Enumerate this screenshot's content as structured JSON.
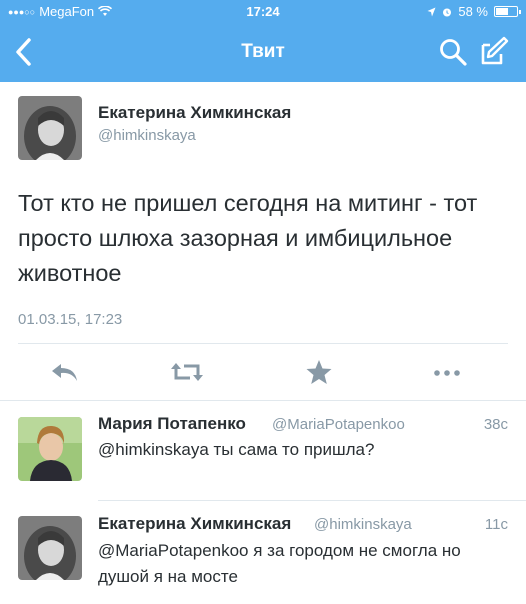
{
  "status_bar": {
    "carrier": "MegaFon",
    "time": "17:24",
    "battery": "58 %",
    "battery_level": 0.58
  },
  "nav": {
    "title": "Твит"
  },
  "tweet": {
    "author_name": "Екатерина Химкинская",
    "author_handle": "@himkinskaya",
    "text": "Тот кто не пришел сегодня на митинг - тот просто шлюха зазорная и имбицильное животное",
    "date": "01.03.15, 17:23"
  },
  "actions": [
    "reply-icon",
    "retweet-icon",
    "favorite-icon",
    "more-icon"
  ],
  "replies": [
    {
      "name": "Мария Потапенко",
      "handle": "@MariaPotapenkoo",
      "time": "38с",
      "text": "@himkinskaya ты сама то пришла?"
    },
    {
      "name": "Екатерина Химкинская",
      "handle": "@himkinskaya",
      "time": "11с",
      "text": "@MariaPotapenkoo я за городом не смогла но душой я на мосте"
    }
  ],
  "colors": {
    "accent": "#55acee",
    "text": "#292f33",
    "muted": "#8899a6",
    "icon": "#8899a6",
    "divider": "#e1e8ed"
  }
}
